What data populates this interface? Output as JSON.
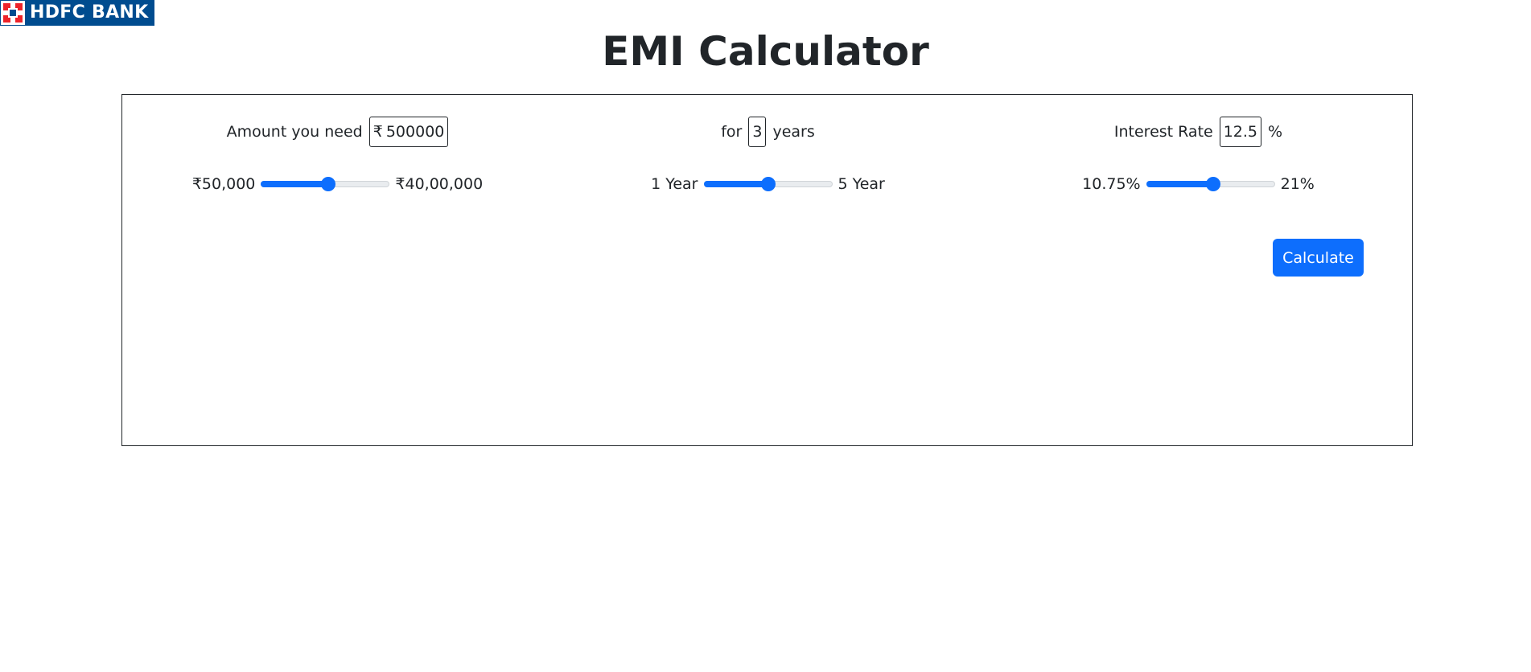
{
  "logo": {
    "text": "HDFC BANK"
  },
  "page": {
    "title": "EMI Calculator"
  },
  "amount": {
    "label": "Amount you need",
    "currency_symbol": "₹",
    "value": "500000",
    "min_label": "₹50,000",
    "max_label": "₹40,00,000",
    "slider_fraction": 0.52
  },
  "tenure": {
    "prefix_label": "for",
    "value": "3",
    "suffix_label": "years",
    "min_label": "1 Year",
    "max_label": "5 Year",
    "slider_fraction": 0.5
  },
  "interest": {
    "label": "Interest Rate",
    "value": "12.5",
    "suffix_label": "%",
    "min_label": "10.75%",
    "max_label": "21%",
    "slider_fraction": 0.52
  },
  "actions": {
    "calculate_label": "Calculate"
  },
  "colors": {
    "brand_blue": "#004c8f",
    "brand_red": "#ed232a",
    "accent": "#0d6efd"
  }
}
